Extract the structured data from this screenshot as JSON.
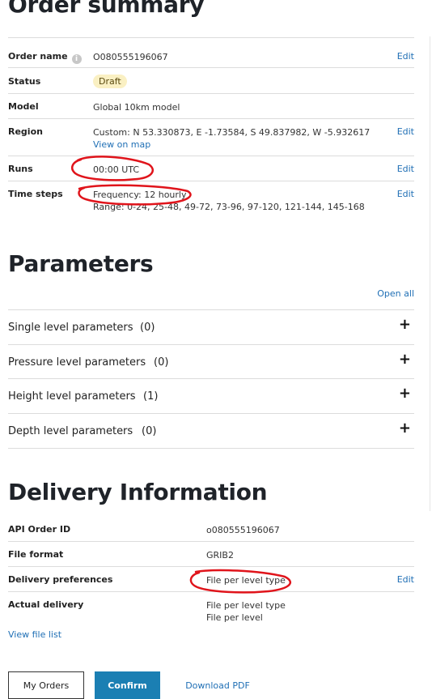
{
  "order_summary": {
    "title": "Order summary",
    "rows": [
      {
        "label": "Order name",
        "value": "O080555196067",
        "edit": "Edit"
      },
      {
        "label": "Status",
        "value": "Draft"
      },
      {
        "label": "Model",
        "value": "Global 10km model"
      },
      {
        "label": "Region",
        "value": "Custom: N 53.330873, E -1.73584, S 49.837982, W -5.932617",
        "link": "View on map",
        "edit": "Edit"
      },
      {
        "label": "Runs",
        "value": "00:00 UTC",
        "edit": "Edit"
      },
      {
        "label": "Time steps",
        "value": "Frequency: 12 hourly",
        "value2": "Range: 0-24, 25-48, 49-72, 73-96, 97-120, 121-144, 145-168",
        "edit": "Edit"
      }
    ]
  },
  "parameters": {
    "title": "Parameters",
    "open_all": "Open all",
    "groups": [
      {
        "label": "Single level parameters",
        "count": "(0)"
      },
      {
        "label": "Pressure level parameters",
        "count": "(0)"
      },
      {
        "label": "Height level parameters",
        "count": "(1)"
      },
      {
        "label": "Depth level parameters",
        "count": "(0)"
      }
    ]
  },
  "delivery": {
    "title": "Delivery Information",
    "rows": [
      {
        "label": "API Order ID",
        "value": "o080555196067"
      },
      {
        "label": "File format",
        "value": "GRIB2"
      },
      {
        "label": "Delivery preferences",
        "value": "File per level type",
        "edit": "Edit"
      },
      {
        "label": "Actual delivery",
        "value": "File per level type",
        "value2": "File per level"
      }
    ],
    "view_file_list": "View file list"
  },
  "buttons": {
    "my_orders": "My Orders",
    "confirm": "Confirm",
    "download_pdf": "Download PDF"
  },
  "colors": {
    "link": "#1f6fb5",
    "confirm": "#1b7fb3",
    "badge": "#faf0c3",
    "annotation": "#e0141b"
  }
}
